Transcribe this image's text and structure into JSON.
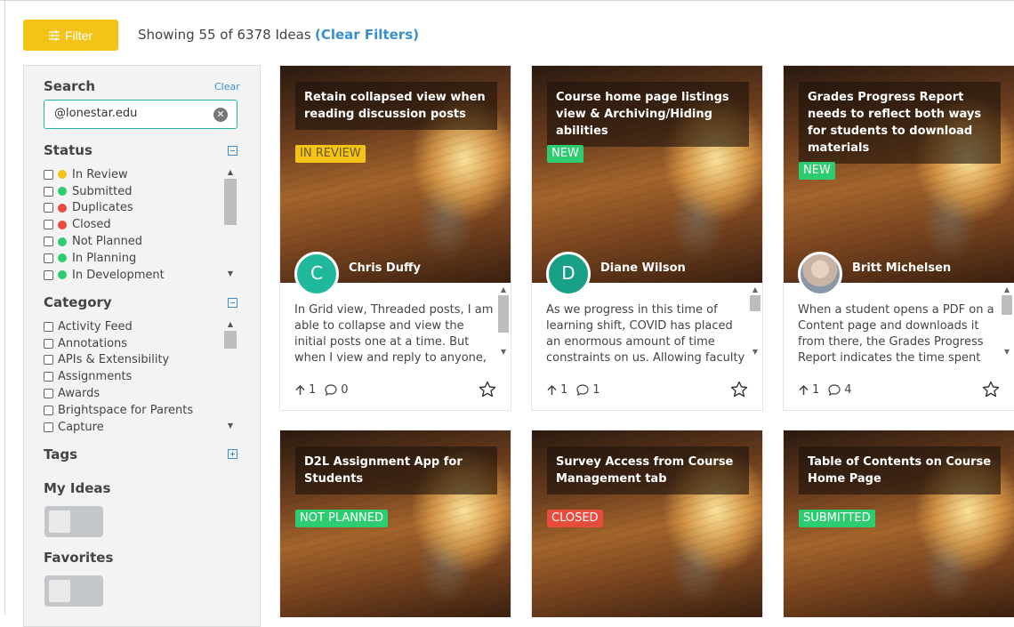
{
  "toolbar": {
    "filter_label": "Filter",
    "showing_text": "Showing 55 of 6378 Ideas",
    "clear_filters_label": "(Clear Filters)"
  },
  "sidebar": {
    "search": {
      "title": "Search",
      "clear_label": "Clear",
      "value": "@lonestar.edu"
    },
    "status": {
      "title": "Status",
      "items": [
        {
          "label": "In Review",
          "color": "#f3c317"
        },
        {
          "label": "Submitted",
          "color": "#2ecc71"
        },
        {
          "label": "Duplicates",
          "color": "#e74c3c"
        },
        {
          "label": "Closed",
          "color": "#e74c3c"
        },
        {
          "label": "Not Planned",
          "color": "#2ecc71"
        },
        {
          "label": "In Planning",
          "color": "#2ecc71"
        },
        {
          "label": "In Development",
          "color": "#2ecc71"
        }
      ]
    },
    "category": {
      "title": "Category",
      "items": [
        "Activity Feed",
        "Annotations",
        "APIs & Extensibility",
        "Assignments",
        "Awards",
        "Brightspace for Parents",
        "Capture"
      ]
    },
    "tags_title": "Tags",
    "my_ideas_title": "My Ideas",
    "favorites_title": "Favorites"
  },
  "cards": [
    {
      "title": "Retain collapsed view when reading discussion posts",
      "status": "IN REVIEW",
      "status_color": "#f3c317",
      "status_text_color": "#6b5a10",
      "author": "Chris Duffy",
      "avatar_letter": "C",
      "avatar_color": "#1fb89b",
      "description": "In Grid view, Threaded posts, I am able to collapse and view the initial posts one at a time. But when I view and reply to anyone, the",
      "votes": "1",
      "comments": "0"
    },
    {
      "title": "Course home page listings view & Archiving/Hiding abilities",
      "status": "NEW",
      "status_color": "#2ecc71",
      "status_text_color": "#ffffff",
      "author": "Diane Wilson",
      "avatar_letter": "D",
      "avatar_color": "#17a085",
      "description": "As we progress in this time of learning shift, COVID has placed an enormous amount of time constraints on us. Allowing faculty the",
      "votes": "1",
      "comments": "1"
    },
    {
      "title": "Grades Progress Report needs to reflect both ways for students to download materials",
      "status": "NEW",
      "status_color": "#2ecc71",
      "status_text_color": "#ffffff",
      "author": "Britt Michelsen",
      "avatar_letter": "",
      "avatar_color": "#c9b7a6",
      "description": "When a student opens a PDF on a Content page and downloads it from there, the Grades Progress Report indicates the time spent",
      "votes": "1",
      "comments": "4"
    },
    {
      "title": "D2L Assignment App for Students",
      "status": "NOT PLANNED",
      "status_color": "#2ecc71",
      "status_text_color": "#ffffff"
    },
    {
      "title": "Survey Access from Course Management tab",
      "status": "CLOSED",
      "status_color": "#e74c3c",
      "status_text_color": "#ffffff"
    },
    {
      "title": "Table of Contents on Course Home Page",
      "status": "SUBMITTED",
      "status_color": "#2ecc71",
      "status_text_color": "#ffffff"
    }
  ]
}
